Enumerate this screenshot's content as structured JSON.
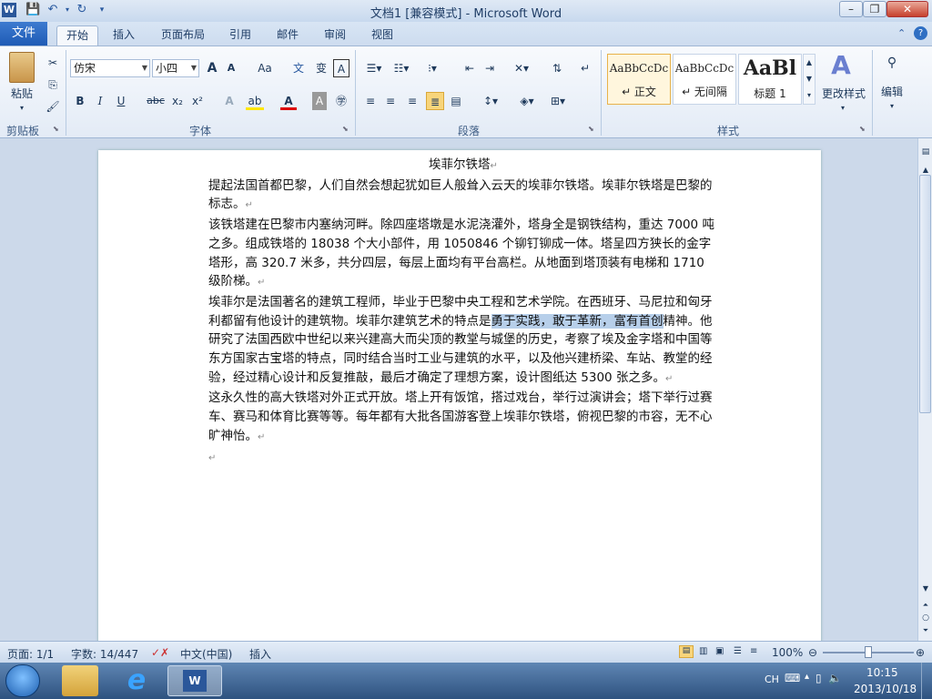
{
  "window": {
    "title": "文档1 [兼容模式] - Microsoft Word"
  },
  "tabs": [
    {
      "label": "文件"
    },
    {
      "label": "开始"
    },
    {
      "label": "插入"
    },
    {
      "label": "页面布局"
    },
    {
      "label": "引用"
    },
    {
      "label": "邮件"
    },
    {
      "label": "审阅"
    },
    {
      "label": "视图"
    }
  ],
  "ribbon": {
    "clipboard": {
      "paste": "粘贴",
      "group": "剪贴板"
    },
    "font": {
      "name": "仿宋",
      "size": "小四",
      "grow": "A",
      "shrink": "A",
      "aa": "Aa",
      "bold": "B",
      "italic": "I",
      "underline": "U",
      "strike": "abc",
      "sub": "x₂",
      "sup": "x²",
      "group": "字体"
    },
    "paragraph": {
      "group": "段落"
    },
    "styles": {
      "items": [
        {
          "sample": "AaBbCcDc",
          "name": "↵ 正文"
        },
        {
          "sample": "AaBbCcDc",
          "name": "↵ 无间隔"
        },
        {
          "sample": "AaBl",
          "name": "标题 1"
        }
      ],
      "change": "更改样式",
      "group": "样式"
    },
    "editing": {
      "label": "编辑"
    }
  },
  "document": {
    "title": "埃菲尔铁塔",
    "paragraphs": [
      {
        "before": "提起法国首都巴黎，人们自然会想起犹如巨人般耸入云天的埃菲尔铁塔。埃菲尔铁塔是巴黎的标志。",
        "selected": "",
        "after": ""
      },
      {
        "before": "该铁塔建在巴黎市内塞纳河畔。除四座塔墩是水泥浇灌外，塔身全是钢铁结构，重达 7000 吨之多。组成铁塔的 18038 个大小部件，用 1050846 个铆钉铆成一体。塔呈四方狭长的金字塔形，高 320.7 米多，共分四层，每层上面均有平台高栏。从地面到塔顶装有电梯和 1710 级阶梯。",
        "selected": "",
        "after": ""
      },
      {
        "before": "埃菲尔是法国著名的建筑工程师，毕业于巴黎中央工程和艺术学院。在西班牙、马尼拉和匈牙利都留有他设计的建筑物。埃菲尔建筑艺术的特点是",
        "selected": "勇于实践，敢于革新，富有首创",
        "after": "精神。他研究了法国西欧中世纪以来兴建高大而尖顶的教堂与城堡的历史，考察了埃及金字塔和中国等东方国家古宝塔的特点，同时结合当时工业与建筑的水平，以及他兴建桥梁、车站、教堂的经验，经过精心设计和反复推敲，最后才确定了理想方案，设计图纸达 5300 张之多。"
      },
      {
        "before": "这永久性的高大铁塔对外正式开放。塔上开有饭馆，搭过戏台，举行过演讲会；塔下举行过赛车、赛马和体育比赛等等。每年都有大批各国游客登上埃菲尔铁塔，俯视巴黎的市容，无不心旷神怡。",
        "selected": "",
        "after": ""
      }
    ],
    "mark": "↵"
  },
  "status": {
    "page": "页面: 1/1",
    "words": "字数: 14/447",
    "lang": "中文(中国)",
    "mode": "插入",
    "zoom": "100%"
  },
  "taskbar": {
    "lang": "CH",
    "time": "10:15",
    "date": "2013/10/18"
  },
  "colors": {
    "accent": "#2b579a",
    "selection": "#b7cfea"
  }
}
